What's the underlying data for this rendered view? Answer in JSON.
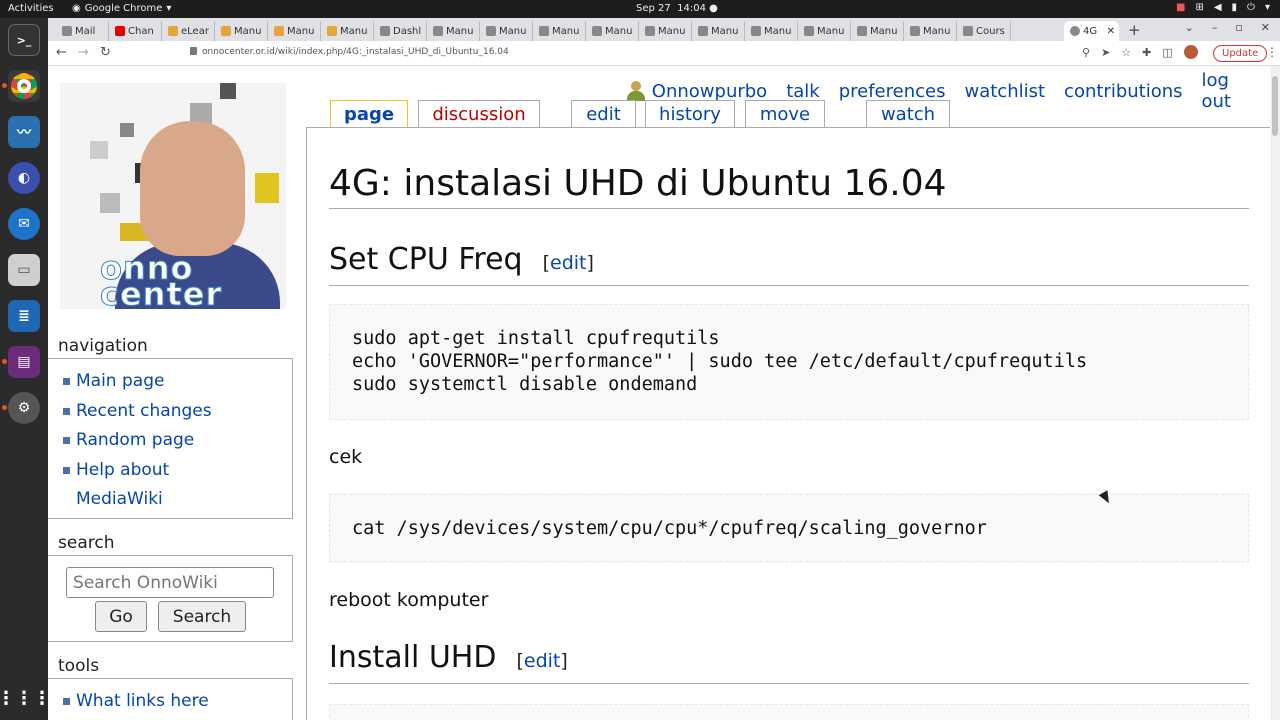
{
  "topbar": {
    "activities": "Activities",
    "app": "Google Chrome",
    "date": "Sep 27",
    "time": "14:04"
  },
  "tabs": [
    "Mail",
    "Chan",
    "eLear",
    "Manu",
    "Manu",
    "Manu",
    "Dashl",
    "Manu",
    "Manu",
    "Manu",
    "Manu",
    "Manu",
    "Manu",
    "Manu",
    "Manu",
    "Manu",
    "Manu",
    "Cours",
    "4G"
  ],
  "address": {
    "url": "onnocenter.or.id/wiki/index.php/4G:_instalasi_UHD_di_Ubuntu_16.04",
    "update_label": "Update"
  },
  "personal": {
    "user": "Onnowpurbo",
    "talk": "talk",
    "preferences": "preferences",
    "watchlist": "watchlist",
    "contributions": "contributions",
    "logout": "log out"
  },
  "page_tabs": {
    "page": "page",
    "discussion": "discussion",
    "edit": "edit",
    "history": "history",
    "move": "move",
    "watch": "watch"
  },
  "logo": {
    "brand_line1": "onno",
    "brand_line2": "center"
  },
  "sidebar": {
    "navigation_title": "navigation",
    "nav_items": [
      "Main page",
      "Recent changes",
      "Random page",
      "Help about",
      "MediaWiki"
    ],
    "search_title": "search",
    "search_placeholder": "Search OnnoWiki",
    "go_label": "Go",
    "search_label": "Search",
    "tools_title": "tools",
    "tools_items": [
      "What links here"
    ]
  },
  "article": {
    "title": "4G: instalasi UHD di Ubuntu 16.04",
    "section1": "Set CPU Freq",
    "edit_label": "edit",
    "code1": "sudo apt-get install cpufrequtils\necho 'GOVERNOR=\"performance\"' | sudo tee /etc/default/cpufrequtils\nsudo systemctl disable ondemand",
    "para1": "cek",
    "code2": "cat /sys/devices/system/cpu/cpu*/cpufreq/scaling_governor",
    "para2": "reboot komputer",
    "section2": "Install UHD"
  }
}
